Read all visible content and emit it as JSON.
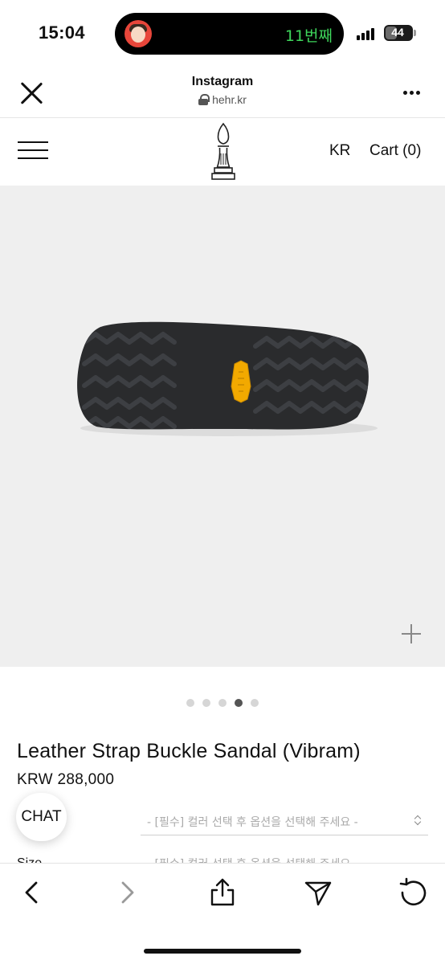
{
  "status_bar": {
    "time": "15:04",
    "island_text": "11번째",
    "battery": "44",
    "battery_level": 0.44
  },
  "browser_header": {
    "title": "Instagram",
    "url": "hehr.kr"
  },
  "site_nav": {
    "lang": "KR",
    "cart": "Cart (0)"
  },
  "carousel": {
    "slide_count": 5,
    "active_index": 3
  },
  "product": {
    "title": "Leather Strap Buckle Sandal (Vibram)",
    "price": "KRW 288,000"
  },
  "chat_label": "CHAT",
  "options": {
    "color_placeholder": "- [필수] 컬러 선택 후 옵션을 선택해 주세요 -",
    "size_label": "Size",
    "size_placeholder": "- [필수] 컬러 선택 후 옵션을 선택해 주세요 -"
  },
  "colors": {
    "island_text": "#3ed65b",
    "image_bg": "#efefef",
    "vibram_logo": "#f2a900"
  }
}
